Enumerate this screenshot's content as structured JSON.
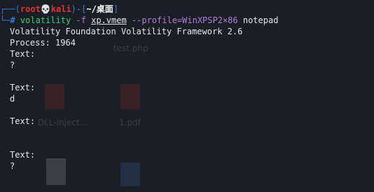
{
  "prompt": {
    "user": "root",
    "skull_glyph": "💀",
    "host": "kali",
    "path": "~/桌面",
    "hash": "#"
  },
  "command": {
    "program": "volatility",
    "flag_f": "-f",
    "file": "xp.vmem",
    "profile_opt": "--profile=WinXPSP2×86",
    "plugin": "notepad"
  },
  "output": {
    "banner": "Volatility Foundation Volatility Framework 2.6",
    "process": "Process: 1964",
    "blocks": [
      {
        "label": "Text:",
        "value": "?"
      },
      {
        "label": "Text:",
        "value": "d"
      },
      {
        "label": "Text:",
        "value": ""
      },
      {
        "label": "Text:",
        "value": "?"
      }
    ]
  },
  "desktop_ghosts": {
    "label_1": "test.php",
    "label_2": "DLL-inject...",
    "label_3": "1.pdf"
  },
  "colors": {
    "background": "#1b1e24",
    "prompt_frame": "#2f7bd9",
    "user": "#e0312b",
    "command": "#33d17a",
    "option": "#b07edb"
  }
}
